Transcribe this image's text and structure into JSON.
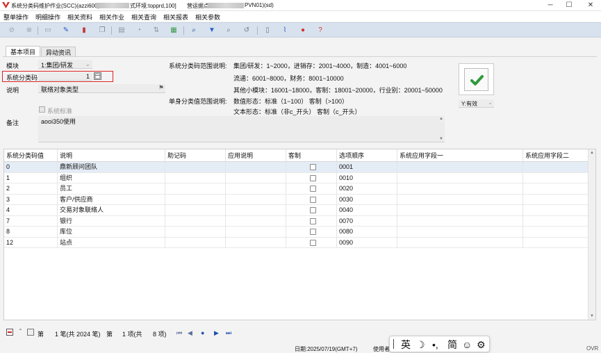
{
  "window": {
    "title_prefix": "系统分类码维护作业(SCC)(azzi600)",
    "title_env": "式环境:topprd,100]",
    "title_op": "营运据点",
    "title_tail": "PVN01)(sd)",
    "minimize": "─",
    "maximize": "☐",
    "close": "✕"
  },
  "menu": [
    "整单操作",
    "明细操作",
    "相关资料",
    "相关作业",
    "相关查询",
    "相关报表",
    "相关参数"
  ],
  "toolbar_icons": [
    {
      "name": "check-circle-icon",
      "glyph": "⊘",
      "color": "#9aa4b2"
    },
    {
      "name": "cancel-circle-icon",
      "glyph": "⊗",
      "color": "#9aa4b2"
    },
    {
      "name": "new-document-icon",
      "glyph": "▭",
      "color": "#8a93a0"
    },
    {
      "name": "edit-pencil-icon",
      "glyph": "✎",
      "color": "#2a58c8"
    },
    {
      "name": "delete-icon",
      "glyph": "▮",
      "color": "#c03a3a"
    },
    {
      "name": "copy-icon",
      "glyph": "❐",
      "color": "#7b8591"
    },
    {
      "name": "print-icon",
      "glyph": "▤",
      "color": "#8a93a0"
    },
    {
      "name": "print-preview-icon",
      "glyph": "◔",
      "color": "#8a93a0"
    },
    {
      "name": "export-icon",
      "glyph": "⇅",
      "color": "#8a93a0"
    },
    {
      "name": "excel-icon",
      "glyph": "▦",
      "color": "#3c9a4a"
    },
    {
      "name": "search-icon",
      "glyph": "⌕",
      "color": "#1f3e8f"
    },
    {
      "name": "filter-icon",
      "glyph": "▼",
      "color": "#2b5fc6"
    },
    {
      "name": "query-zoom-icon",
      "glyph": "⌕",
      "color": "#6b7480"
    },
    {
      "name": "refresh-icon",
      "glyph": "↺",
      "color": "#6b7480"
    },
    {
      "name": "document-icon",
      "glyph": "▯",
      "color": "#6b7480"
    },
    {
      "name": "attachment-icon",
      "glyph": "⌇",
      "color": "#2b5fc6"
    },
    {
      "name": "location-pin-icon",
      "glyph": "●",
      "color": "#d0302f"
    },
    {
      "name": "help-icon",
      "glyph": "?",
      "color": "#d0302f"
    }
  ],
  "tabs": [
    "基本项目",
    "异动资讯"
  ],
  "form": {
    "module_label": "模块",
    "module_value": "1:集团/研发",
    "code_label": "系统分类码",
    "code_value": "1",
    "desc_label": "说明",
    "desc_value": "联络对象类型",
    "standard_label": "系统标准",
    "note_label": "备注",
    "note_value": "aooi350使用",
    "range_label": "系统分类码范围说明:",
    "range_lines": [
      "集团/研发：1~2000，进销存：2001~4000，制造：4001~6000",
      "流通：6001~8000，财务：8001~10000",
      "其他小模块：16001~18000，客制：18001~20000，行业别：20001~50000"
    ],
    "value_range_label": "单身分类值范围说明:",
    "value_range_lines": [
      "数值形态：标准（1~100）     客制（>100）",
      "文本形态：标准（非c_开头）   客制（c_开头）"
    ],
    "status_value": "Y:有效"
  },
  "grid": {
    "headers": [
      "系统分类码值",
      "说明",
      "助记码",
      "应用说明",
      "客制",
      "选项顺序",
      "系统应用字段一",
      "系统应用字段二"
    ],
    "rows": [
      {
        "code": "0",
        "desc": "鼎新顾问团队",
        "mnemonic": "",
        "usage": "",
        "custom": false,
        "order": "0001"
      },
      {
        "code": "1",
        "desc": "组织",
        "mnemonic": "",
        "usage": "",
        "custom": false,
        "order": "0010"
      },
      {
        "code": "2",
        "desc": "员工",
        "mnemonic": "",
        "usage": "",
        "custom": false,
        "order": "0020"
      },
      {
        "code": "3",
        "desc": "客户/供应商",
        "mnemonic": "",
        "usage": "",
        "custom": false,
        "order": "0030"
      },
      {
        "code": "4",
        "desc": "交易对象联络人",
        "mnemonic": "",
        "usage": "",
        "custom": false,
        "order": "0040"
      },
      {
        "code": "7",
        "desc": "银行",
        "mnemonic": "",
        "usage": "",
        "custom": false,
        "order": "0070"
      },
      {
        "code": "8",
        "desc": "库位",
        "mnemonic": "",
        "usage": "",
        "custom": false,
        "order": "0080"
      },
      {
        "code": "12",
        "desc": "站点",
        "mnemonic": "",
        "usage": "",
        "custom": false,
        "order": "0090"
      }
    ]
  },
  "status": {
    "page_label": "第",
    "record_info": "1 笔(共 2024 笔)",
    "page_label2": "第",
    "item_info": "1 项(共",
    "item_total": "8 项)",
    "date": "日期:2025/07/19(GMT+7)",
    "user": "使用者",
    "ovr": "OVR"
  },
  "ime": {
    "lang": "英",
    "moon": "☽",
    "punct": "•,",
    "simp": "简",
    "emoji": "☺",
    "settings": "⚙"
  },
  "colors": {
    "accent_red": "#e02020",
    "confirm_green": "#2f9a3a",
    "toolbar_bg": "#d8e2ef",
    "selected_row": "#e4ecf6"
  }
}
